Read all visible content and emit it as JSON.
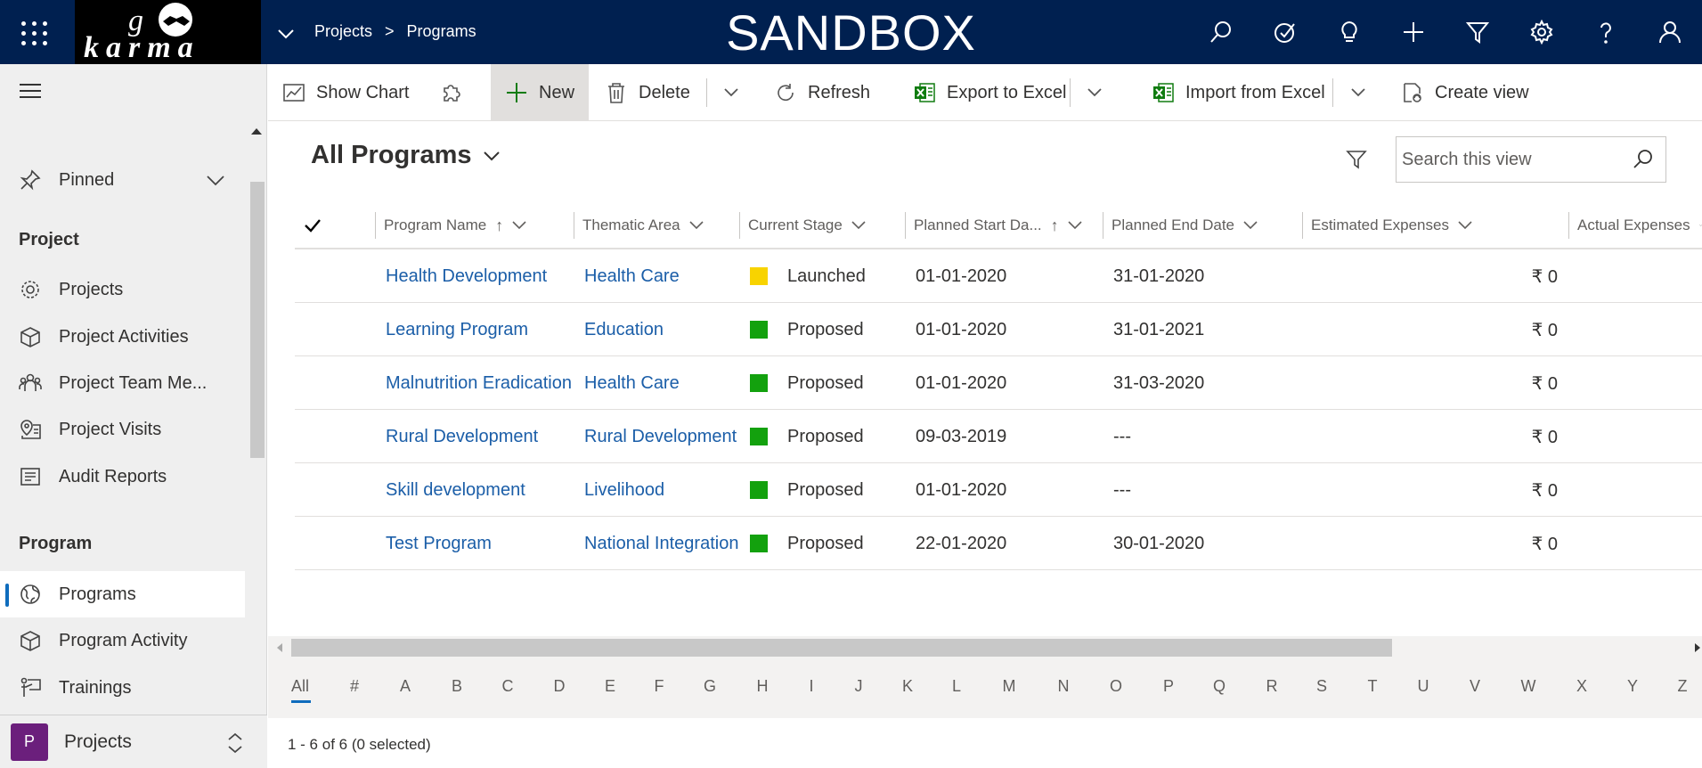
{
  "header": {
    "breadcrumb": [
      "Projects",
      "Programs"
    ],
    "breadcrumb_sep": ">",
    "environment": "SANDBOX",
    "logo_text": "go karma",
    "icons": [
      "search-icon",
      "task-icon",
      "lightbulb-icon",
      "add-icon",
      "filter-icon",
      "settings-icon",
      "help-icon",
      "user-icon"
    ]
  },
  "sidebar": {
    "pinned_label": "Pinned",
    "sections": [
      {
        "title": "Project",
        "items": [
          {
            "label": "Projects",
            "icon": "gear-icon"
          },
          {
            "label": "Project Activities",
            "icon": "cube-icon"
          },
          {
            "label": "Project Team Me...",
            "icon": "team-icon"
          },
          {
            "label": "Project Visits",
            "icon": "map-pin-icon"
          },
          {
            "label": "Audit Reports",
            "icon": "report-icon"
          }
        ]
      },
      {
        "title": "Program",
        "items": [
          {
            "label": "Programs",
            "icon": "globe-icon",
            "active": true
          },
          {
            "label": "Program Activity",
            "icon": "cube-icon"
          },
          {
            "label": "Trainings",
            "icon": "training-icon"
          }
        ]
      }
    ],
    "area": {
      "badge": "P",
      "label": "Projects"
    }
  },
  "commandbar": {
    "show_chart": "Show Chart",
    "new": "New",
    "delete": "Delete",
    "refresh": "Refresh",
    "export": "Export to Excel",
    "import": "Import from Excel",
    "create_view": "Create view"
  },
  "view": {
    "title": "All Programs",
    "search_placeholder": "Search this view"
  },
  "grid": {
    "columns": [
      "Program Name",
      "Thematic Area",
      "Current Stage",
      "Planned Start Da...",
      "Planned End Date",
      "Estimated Expenses",
      "Actual Expenses"
    ],
    "rows": [
      {
        "name": "Health Development",
        "area": "Health Care",
        "stage": "Launched",
        "stage_color": "#f8d300",
        "start": "01-01-2020",
        "end": "31-01-2020",
        "estimated": "₹ 0"
      },
      {
        "name": "Learning Program",
        "area": "Education",
        "stage": "Proposed",
        "stage_color": "#13a10e",
        "start": "01-01-2020",
        "end": "31-01-2021",
        "estimated": "₹ 0"
      },
      {
        "name": "Malnutrition Eradication",
        "area": "Health Care",
        "stage": "Proposed",
        "stage_color": "#13a10e",
        "start": "01-01-2020",
        "end": "31-03-2020",
        "estimated": "₹ 0"
      },
      {
        "name": "Rural Development",
        "area": "Rural Development",
        "stage": "Proposed",
        "stage_color": "#13a10e",
        "start": "09-03-2019",
        "end": "---",
        "estimated": "₹ 0"
      },
      {
        "name": "Skill development",
        "area": "Livelihood",
        "stage": "Proposed",
        "stage_color": "#13a10e",
        "start": "01-01-2020",
        "end": "---",
        "estimated": "₹ 0"
      },
      {
        "name": "Test Program",
        "area": "National Integration",
        "stage": "Proposed",
        "stage_color": "#13a10e",
        "start": "22-01-2020",
        "end": "30-01-2020",
        "estimated": "₹ 0"
      }
    ]
  },
  "jumpbar": [
    "All",
    "#",
    "A",
    "B",
    "C",
    "D",
    "E",
    "F",
    "G",
    "H",
    "I",
    "J",
    "K",
    "L",
    "M",
    "N",
    "O",
    "P",
    "Q",
    "R",
    "S",
    "T",
    "U",
    "V",
    "W",
    "X",
    "Y",
    "Z"
  ],
  "footer": {
    "status": "1 - 6 of 6 (0 selected)"
  }
}
